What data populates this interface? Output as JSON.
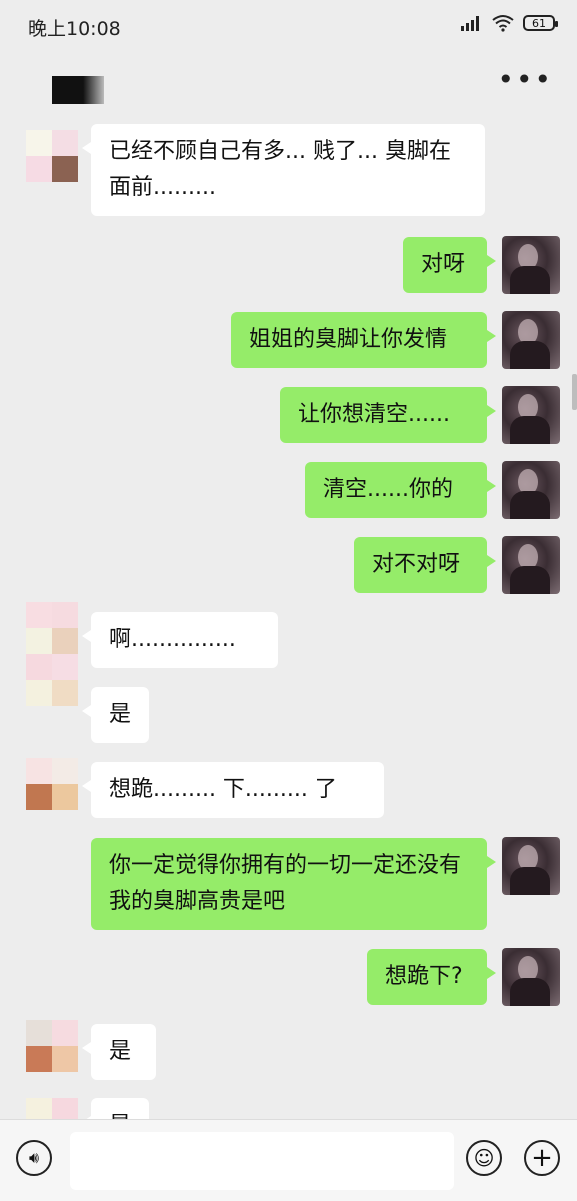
{
  "status": {
    "time": "晚上10:08",
    "battery": "61"
  },
  "header": {
    "more_icon": "more-dots-icon"
  },
  "messages": [
    {
      "side": "in",
      "text": "已经不顾自己有多... 贱了... 臭脚在面前........."
    },
    {
      "side": "out",
      "text": "对呀"
    },
    {
      "side": "out",
      "text": "姐姐的臭脚让你发情"
    },
    {
      "side": "out",
      "text": "让你想清空......"
    },
    {
      "side": "out",
      "text": "清空......你的"
    },
    {
      "side": "out",
      "text": "对不对呀"
    },
    {
      "side": "in",
      "text": "啊..............."
    },
    {
      "side": "in",
      "text": "是"
    },
    {
      "side": "in",
      "text": "想跪......... 下......... 了"
    },
    {
      "side": "out",
      "text": "你一定觉得你拥有的一切一定还没有我的臭脚高贵是吧"
    },
    {
      "side": "out",
      "text": "想跪下?"
    },
    {
      "side": "in",
      "text": "是"
    },
    {
      "side": "in",
      "text": "是"
    }
  ],
  "input": {
    "placeholder": ""
  },
  "colors": {
    "incoming": "#ffffff",
    "outgoing": "#95ec69",
    "background": "#ededed"
  }
}
